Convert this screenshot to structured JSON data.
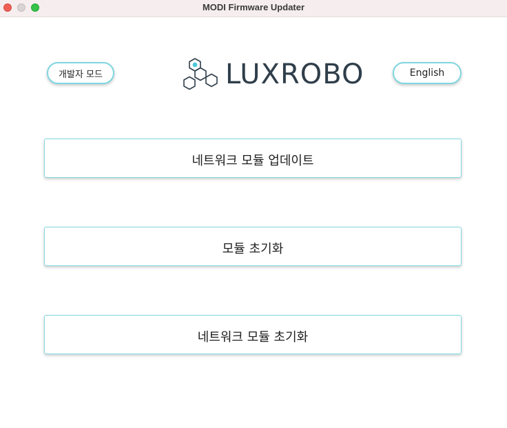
{
  "window": {
    "title": "MODI Firmware Updater"
  },
  "header": {
    "dev_mode_label": "개발자 모드",
    "language_label": "English",
    "logo_text": "LUXROBO",
    "logo_icon": "hexagon-molecule-icon"
  },
  "menu": {
    "items": [
      {
        "label": "네트워크 모듈 업데이트"
      },
      {
        "label": "모듈 초기화"
      },
      {
        "label": "네트워크 모듈 초기화"
      }
    ]
  },
  "colors": {
    "accent": "#7fd6df",
    "logo": "#2f3e4a",
    "logo_dot": "#4ec9d9",
    "titlebar": "#f6eeee"
  }
}
